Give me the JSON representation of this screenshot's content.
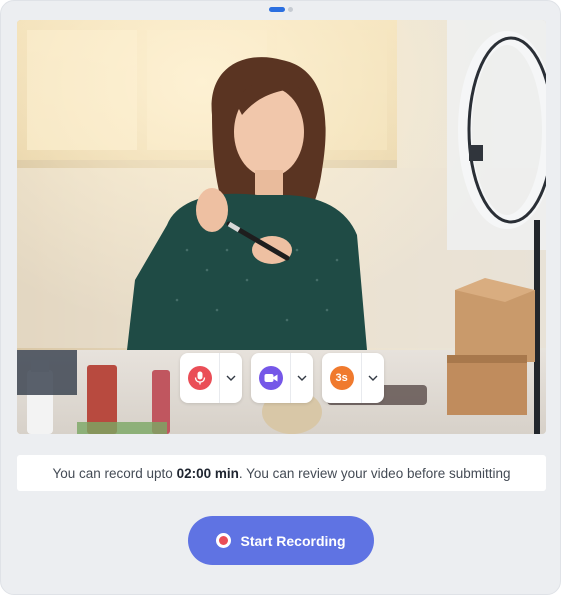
{
  "pagination": {
    "pages": 2,
    "active_index": 0
  },
  "preview": {
    "description_icon": "camera-preview"
  },
  "controls": [
    {
      "name": "microphone",
      "icon": "microphone-icon",
      "color": "#ea4e57"
    },
    {
      "name": "camera",
      "icon": "video-camera-icon",
      "color": "#7557e8"
    },
    {
      "name": "countdown",
      "icon": "timer-icon",
      "label": "3s",
      "color": "#f07a2e"
    }
  ],
  "info": {
    "text_before": "You can record upto ",
    "duration": "02:00 min",
    "text_after": ". You can review your video before submitting"
  },
  "start_button": {
    "label": "Start Recording",
    "color": "#5f73e3",
    "dot_color": "#ea4e57"
  }
}
